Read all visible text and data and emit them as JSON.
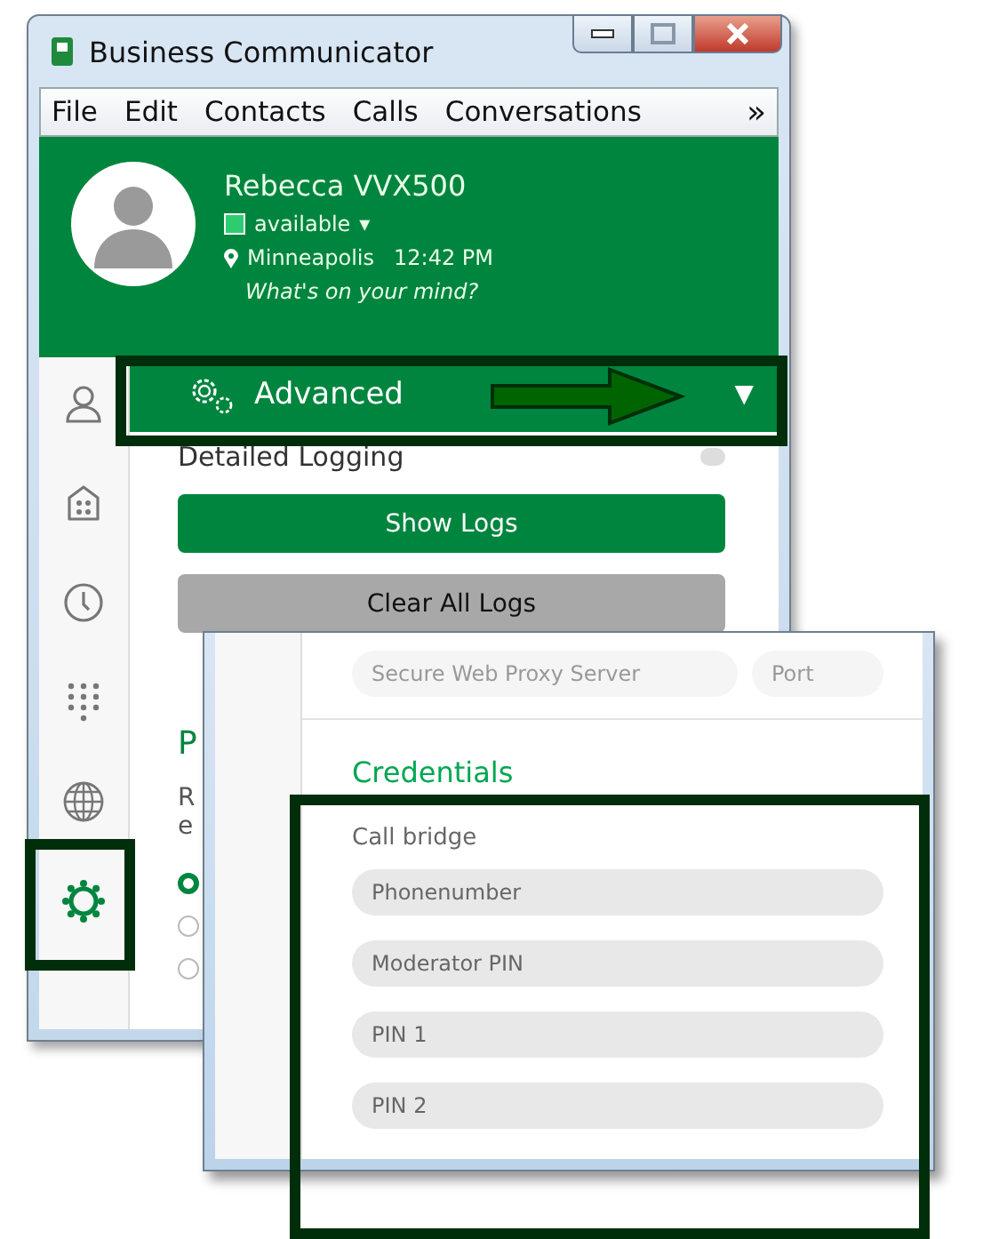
{
  "window": {
    "title": "Business Communicator"
  },
  "menu": {
    "items": [
      {
        "label": "File"
      },
      {
        "label": "Edit"
      },
      {
        "label": "Contacts"
      },
      {
        "label": "Calls"
      },
      {
        "label": "Conversations"
      }
    ],
    "overflow": "»"
  },
  "profile": {
    "name": "Rebecca VVX500",
    "status": "available",
    "status_caret": "▾",
    "location": "Minneapolis",
    "time": "12:42 PM",
    "mood_placeholder": "What's on your mind?"
  },
  "sidebar": {
    "items": [
      {
        "kind": "person",
        "selected": false
      },
      {
        "kind": "apps",
        "selected": false
      },
      {
        "kind": "clock",
        "selected": false
      },
      {
        "kind": "dialpad",
        "selected": false
      },
      {
        "kind": "globe",
        "selected": false
      },
      {
        "kind": "gear",
        "selected": true
      }
    ]
  },
  "settings": {
    "section_title": "Advanced",
    "section_caret": "▼",
    "detailed_logging": {
      "label": "Detailed Logging",
      "on": false
    },
    "buttons": [
      {
        "label": "Show Logs",
        "kind": "primary"
      },
      {
        "label": "Clear All Logs",
        "kind": "secondary"
      }
    ],
    "heading": "P",
    "lines": [
      "R",
      "e"
    ],
    "radios": [
      {
        "selected": true
      },
      {
        "selected": false
      },
      {
        "selected": false
      }
    ]
  },
  "overlay": {
    "proxy": {
      "placeholder": "Secure Web Proxy Server"
    },
    "port": {
      "placeholder": "Port"
    },
    "heading": "Credentials",
    "group": "Call bridge",
    "fields": [
      {
        "placeholder": "Phonenumber"
      },
      {
        "placeholder": "Moderator PIN"
      },
      {
        "placeholder": "PIN 1"
      },
      {
        "placeholder": "PIN 2"
      }
    ]
  }
}
